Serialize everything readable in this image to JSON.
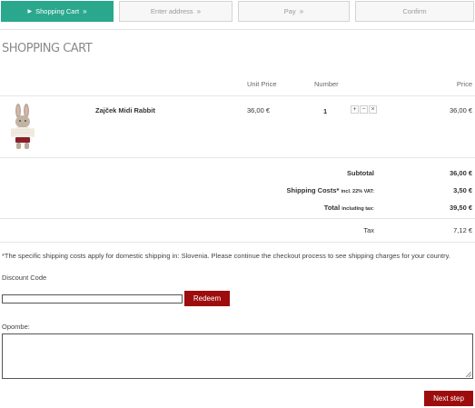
{
  "steps": [
    {
      "label": "Shopping Cart",
      "active": true
    },
    {
      "label": "Enter address"
    },
    {
      "label": "Pay"
    },
    {
      "label": "Confirm"
    }
  ],
  "step_separator": "»",
  "page_title": "SHOPPING CART",
  "table": {
    "headers": {
      "unit_price": "Unit Price",
      "number": "Number",
      "price": "Price"
    },
    "items": [
      {
        "name": "Zajček Midi Rabbit",
        "unit_price": "36,00 €",
        "quantity": "1",
        "price": "36,00 €",
        "image": "rabbit-toy"
      }
    ],
    "qty_controls": {
      "plus": "+",
      "minus": "−",
      "remove": "×"
    }
  },
  "totals": {
    "subtotal_label": "Subtotal",
    "subtotal_value": "36,00 €",
    "shipping_label": "Shipping Costs*",
    "shipping_note": "incl. 22% VAT:",
    "shipping_value": "3,50 €",
    "total_label": "Total",
    "total_note": "including tax:",
    "total_value": "39,50 €",
    "tax_label": "Tax",
    "tax_value": "7,12 €"
  },
  "shipping_notice": "*The specific shipping costs apply for domestic shipping in: Slovenia. Please continue the checkout process to see shipping charges for your country.",
  "discount": {
    "label": "Discount Code",
    "value": "",
    "button": "Redeem"
  },
  "notes": {
    "label": "Opombe:",
    "value": ""
  },
  "next_button": "Next step",
  "colors": {
    "accent": "#2aa88e",
    "button": "#9d0d0d"
  }
}
